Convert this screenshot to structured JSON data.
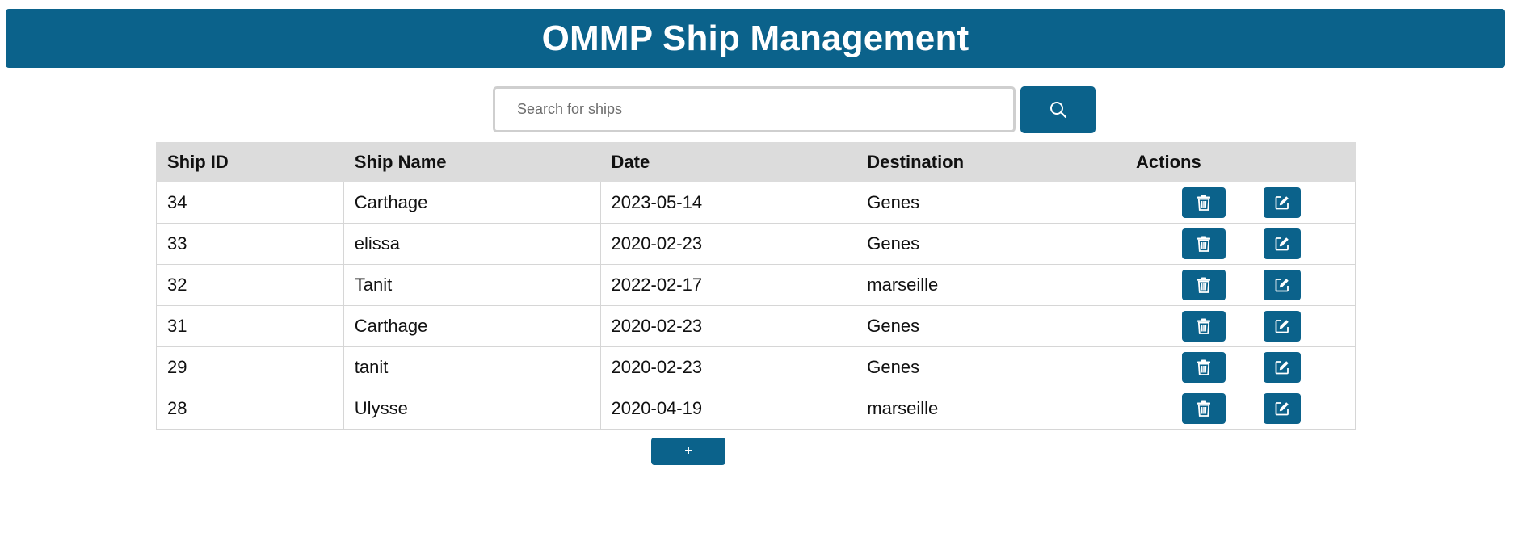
{
  "header": {
    "title": "OMMP Ship Management"
  },
  "search": {
    "placeholder": "Search for ships",
    "value": "",
    "button_icon": "search-icon"
  },
  "table": {
    "columns": [
      "Ship ID",
      "Ship Name",
      "Date",
      "Destination",
      "Actions"
    ],
    "rows": [
      {
        "id": "34",
        "name": "Carthage",
        "date": "2023-05-14",
        "destination": "Genes"
      },
      {
        "id": "33",
        "name": "elissa",
        "date": "2020-02-23",
        "destination": "Genes"
      },
      {
        "id": "32",
        "name": "Tanit",
        "date": "2022-02-17",
        "destination": "marseille"
      },
      {
        "id": "31",
        "name": "Carthage",
        "date": "2020-02-23",
        "destination": "Genes"
      },
      {
        "id": "29",
        "name": "tanit",
        "date": "2020-02-23",
        "destination": "Genes"
      },
      {
        "id": "28",
        "name": "Ulysse",
        "date": "2020-04-19",
        "destination": "marseille"
      }
    ],
    "row_actions": [
      "trash-icon",
      "edit-icon"
    ]
  },
  "add_button": {
    "label": "+"
  },
  "colors": {
    "primary": "#0b628b",
    "header_row_bg": "#dcdcdc",
    "border": "#d6d6d6"
  }
}
